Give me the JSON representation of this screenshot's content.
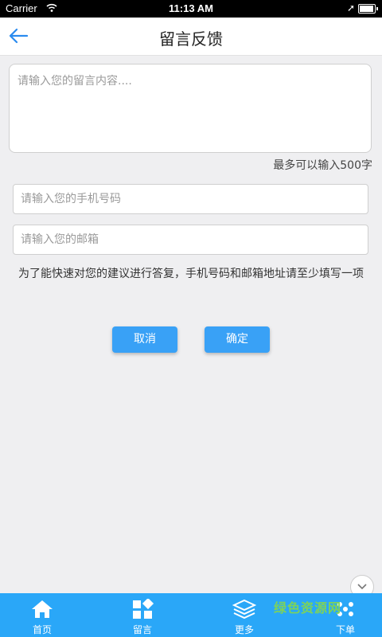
{
  "status": {
    "carrier": "Carrier",
    "time": "11:13 AM"
  },
  "nav": {
    "title": "留言反馈"
  },
  "form": {
    "message_placeholder": "请输入您的留言内容....",
    "counter": "最多可以输入500字",
    "phone_placeholder": "请输入您的手机号码",
    "email_placeholder": "请输入您的邮箱",
    "hint": "为了能快速对您的建议进行答复，手机号码和邮箱地址请至少填写一项",
    "cancel_label": "取消",
    "confirm_label": "确定"
  },
  "tabs": [
    {
      "label": "首页",
      "icon": "home-icon"
    },
    {
      "label": "留言",
      "icon": "grid-icon"
    },
    {
      "label": "更多",
      "icon": "layers-icon"
    },
    {
      "label": "下单",
      "icon": "dots-icon"
    }
  ],
  "watermark": "绿色资源网",
  "colors": {
    "accent": "#39a1f6",
    "tabbar": "#2aa7f8",
    "background": "#efeff1"
  }
}
